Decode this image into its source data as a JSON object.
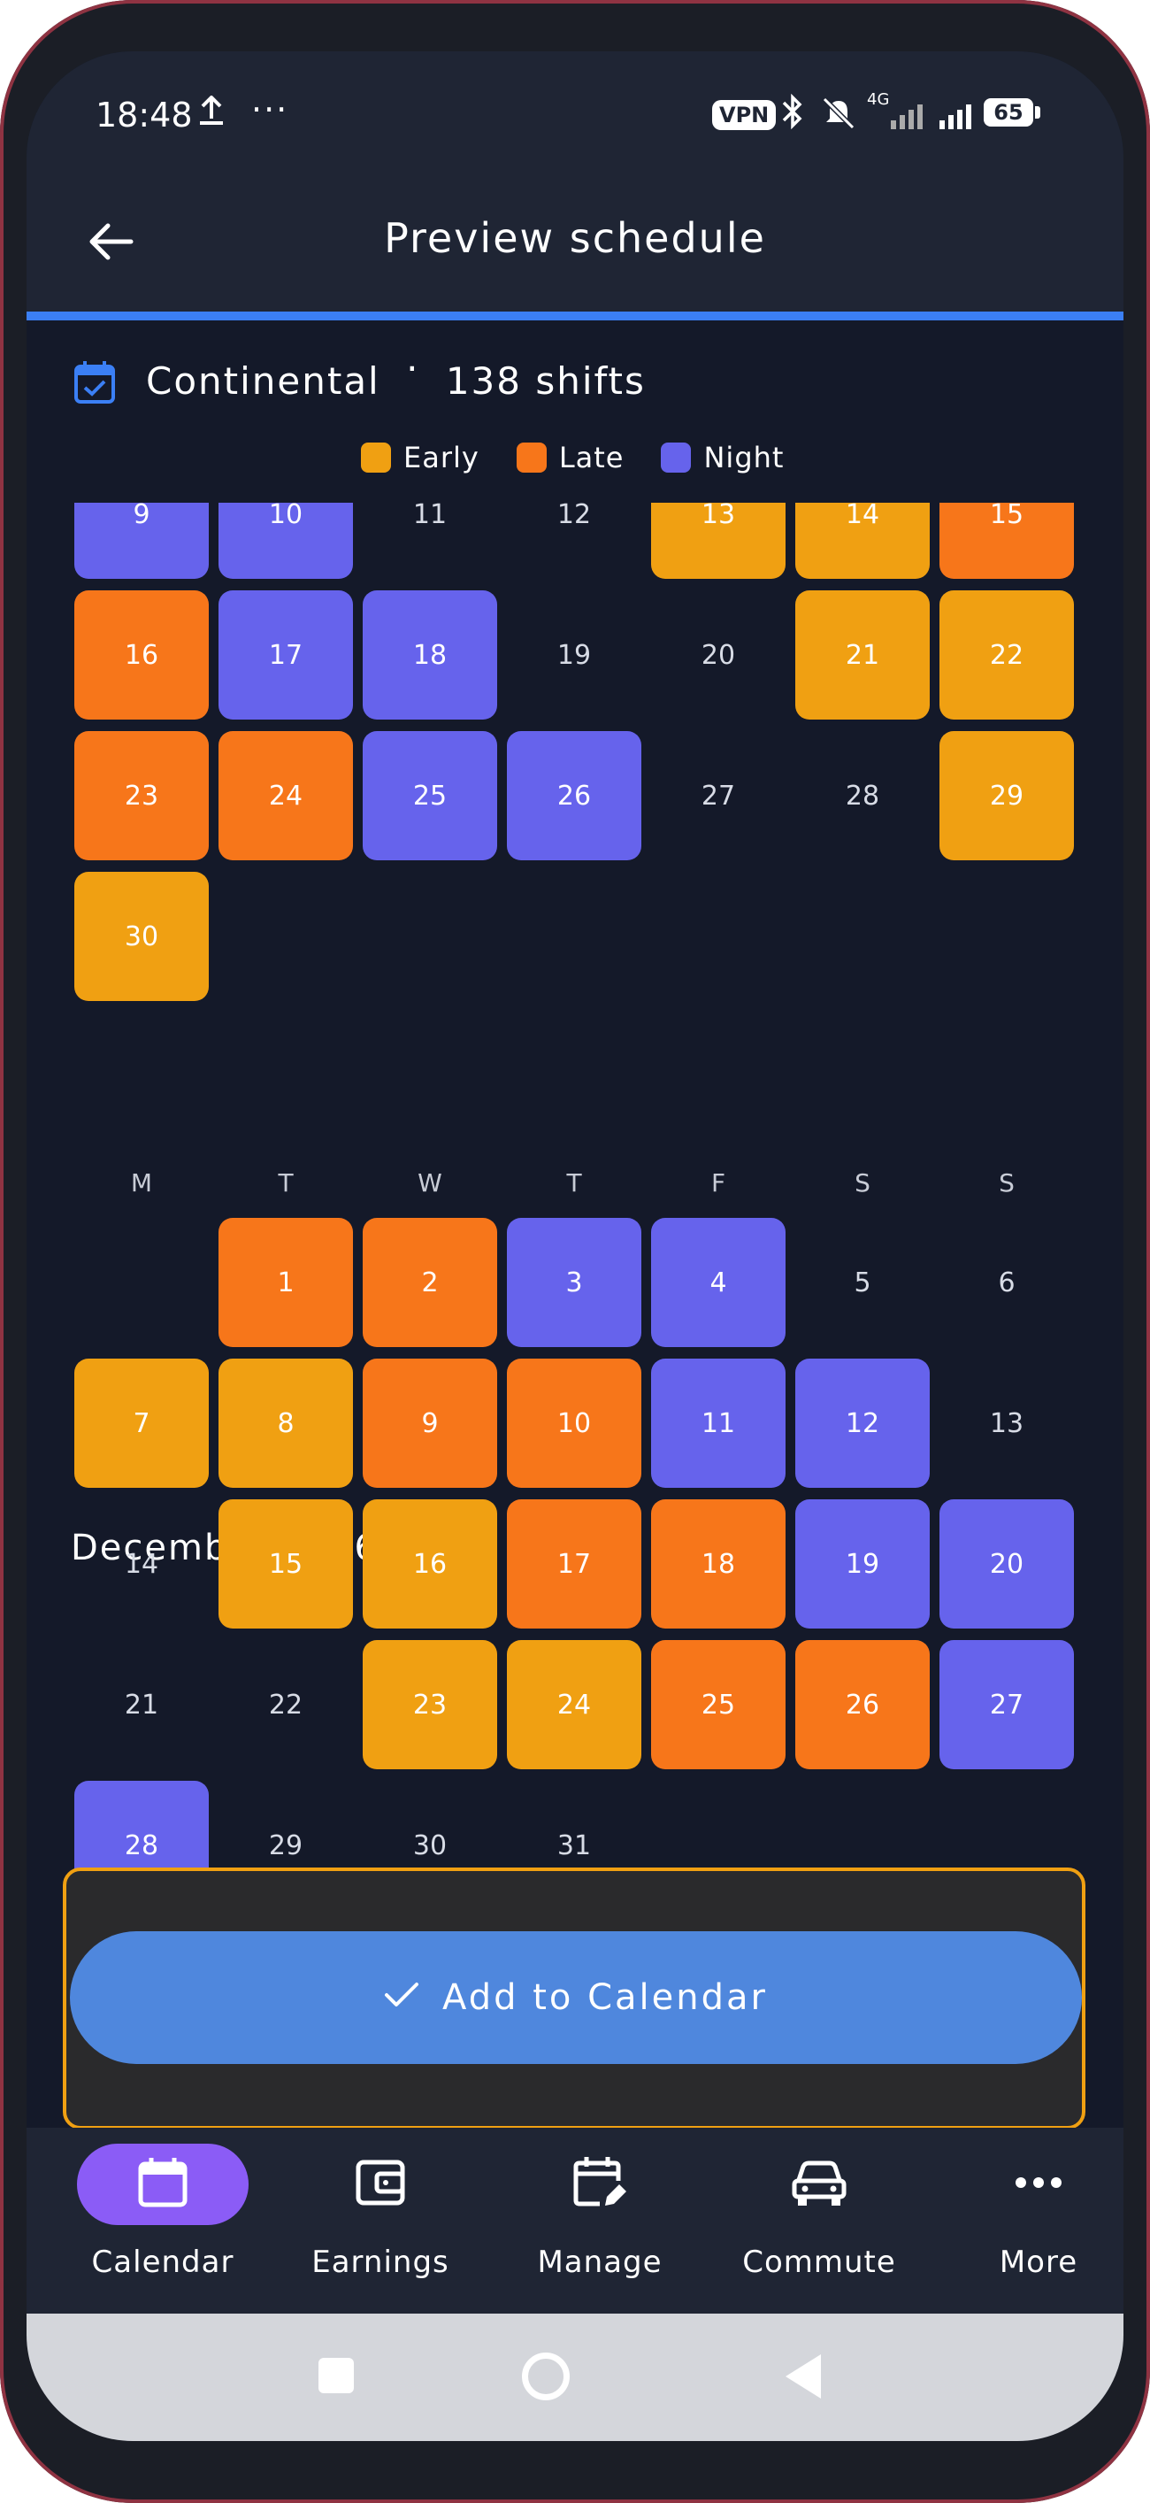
{
  "status_bar": {
    "time": "18:48",
    "dots": "···",
    "vpn": "VPN",
    "network": "4G",
    "battery": "65"
  },
  "header": {
    "title": "Preview schedule"
  },
  "schedule": {
    "name": "Continental",
    "separator": "·",
    "shifts_label": "138 shifts"
  },
  "legend": [
    {
      "label": "Early",
      "color": "#f0a012"
    },
    {
      "label": "Late",
      "color": "#f7761a"
    },
    {
      "label": "Night",
      "color": "#6663ec"
    }
  ],
  "november": {
    "rows": [
      [
        {
          "d": "9",
          "t": "night"
        },
        {
          "d": "10",
          "t": "night"
        },
        {
          "d": "11",
          "t": ""
        },
        {
          "d": "12",
          "t": ""
        },
        {
          "d": "13",
          "t": "early"
        },
        {
          "d": "14",
          "t": "early"
        },
        {
          "d": "15",
          "t": "late"
        }
      ],
      [
        {
          "d": "16",
          "t": "late"
        },
        {
          "d": "17",
          "t": "night"
        },
        {
          "d": "18",
          "t": "night"
        },
        {
          "d": "19",
          "t": ""
        },
        {
          "d": "20",
          "t": ""
        },
        {
          "d": "21",
          "t": "early"
        },
        {
          "d": "22",
          "t": "early"
        }
      ],
      [
        {
          "d": "23",
          "t": "late"
        },
        {
          "d": "24",
          "t": "late"
        },
        {
          "d": "25",
          "t": "night"
        },
        {
          "d": "26",
          "t": "night"
        },
        {
          "d": "27",
          "t": ""
        },
        {
          "d": "28",
          "t": ""
        },
        {
          "d": "29",
          "t": "early"
        }
      ],
      [
        {
          "d": "30",
          "t": "early"
        }
      ]
    ]
  },
  "december": {
    "title": "December 2026",
    "weekdays": [
      "M",
      "T",
      "W",
      "T",
      "F",
      "S",
      "S"
    ],
    "rows": [
      [
        null,
        {
          "d": "1",
          "t": "late"
        },
        {
          "d": "2",
          "t": "late"
        },
        {
          "d": "3",
          "t": "night"
        },
        {
          "d": "4",
          "t": "night"
        },
        {
          "d": "5",
          "t": ""
        },
        {
          "d": "6",
          "t": ""
        }
      ],
      [
        {
          "d": "7",
          "t": "early"
        },
        {
          "d": "8",
          "t": "early"
        },
        {
          "d": "9",
          "t": "late"
        },
        {
          "d": "10",
          "t": "late"
        },
        {
          "d": "11",
          "t": "night"
        },
        {
          "d": "12",
          "t": "night"
        },
        {
          "d": "13",
          "t": ""
        }
      ],
      [
        {
          "d": "14",
          "t": ""
        },
        {
          "d": "15",
          "t": "early"
        },
        {
          "d": "16",
          "t": "early"
        },
        {
          "d": "17",
          "t": "late"
        },
        {
          "d": "18",
          "t": "late"
        },
        {
          "d": "19",
          "t": "night"
        },
        {
          "d": "20",
          "t": "night"
        }
      ],
      [
        {
          "d": "21",
          "t": ""
        },
        {
          "d": "22",
          "t": ""
        },
        {
          "d": "23",
          "t": "early"
        },
        {
          "d": "24",
          "t": "early"
        },
        {
          "d": "25",
          "t": "late"
        },
        {
          "d": "26",
          "t": "late"
        },
        {
          "d": "27",
          "t": "night"
        }
      ],
      [
        {
          "d": "28",
          "t": "night"
        },
        {
          "d": "29",
          "t": ""
        },
        {
          "d": "30",
          "t": ""
        },
        {
          "d": "31",
          "t": ""
        }
      ]
    ]
  },
  "add_button": {
    "label": "Add to Calendar"
  },
  "nav": [
    {
      "label": "Calendar",
      "icon": "calendar-icon",
      "active": true
    },
    {
      "label": "Earnings",
      "icon": "wallet-icon",
      "active": false
    },
    {
      "label": "Manage",
      "icon": "calendar-edit-icon",
      "active": false
    },
    {
      "label": "Commute",
      "icon": "car-icon",
      "active": false
    },
    {
      "label": "More",
      "icon": "more-icon",
      "active": false
    }
  ],
  "colors": {
    "accent": "#3b7ff5",
    "early": "#f0a012",
    "late": "#f7761a",
    "night": "#6663ec",
    "nav_active": "#8b5cf6",
    "button": "#4f87dd"
  }
}
